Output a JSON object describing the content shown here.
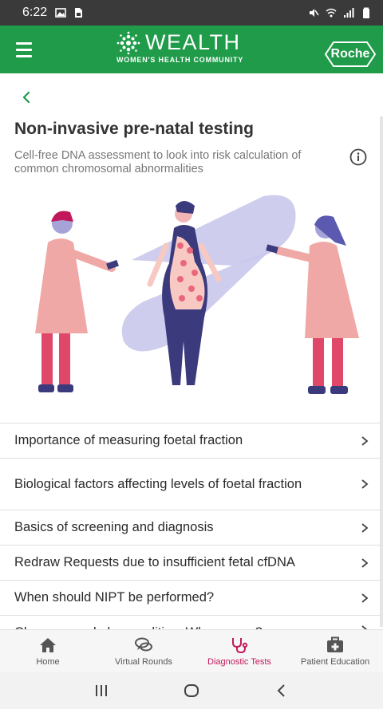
{
  "status_bar": {
    "time": "6:22"
  },
  "brand": {
    "name": "WEALTH",
    "tagline": "WOMEN'S HEALTH COMMUNITY",
    "partner": "Roche",
    "color": "#1f9b4a"
  },
  "page": {
    "title": "Non-invasive pre-natal testing",
    "subtitle": "Cell-free DNA assessment to look into risk calculation of common chromosomal abnormalities"
  },
  "topics": [
    {
      "label": "Importance of measuring foetal fraction"
    },
    {
      "label": "Biological factors affecting levels of foetal fraction"
    },
    {
      "label": "Basics of screening and diagnosis"
    },
    {
      "label": "Redraw Requests due to insufficient fetal cfDNA"
    },
    {
      "label": "When should NIPT be performed?"
    },
    {
      "label": "Chromosomal abnormalities: Why screen?"
    }
  ],
  "bottom_nav": {
    "items": [
      {
        "label": "Home",
        "icon": "home-icon"
      },
      {
        "label": "Virtual Rounds",
        "icon": "chat-icon"
      },
      {
        "label": "Diagnostic Tests",
        "icon": "stethoscope-icon",
        "active": true
      },
      {
        "label": "Patient Education",
        "icon": "medical-kit-icon"
      }
    ],
    "active_color": "#c2185b"
  }
}
